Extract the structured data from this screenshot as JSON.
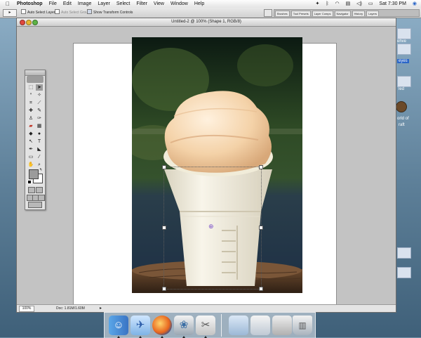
{
  "menubar": {
    "apple": "",
    "items": [
      "Photoshop",
      "File",
      "Edit",
      "Image",
      "Layer",
      "Select",
      "Filter",
      "View",
      "Window",
      "Help"
    ],
    "clock": "Sat 7:30 PM"
  },
  "options_bar": {
    "tool_glyph": "▸",
    "auto_select_layer": "Auto Select Layer",
    "auto_select_groups": "Auto Select Groups",
    "show_transform_controls": "Show Transform Controls",
    "palette_tabs": [
      "Brushes",
      "Tool Presets",
      "Layer Comps",
      "Navigator",
      "History",
      "Layers"
    ]
  },
  "document": {
    "title": "Untitled-2 @ 100% (Shape 1, RGB/8)",
    "zoom": "100%",
    "doc_size": "Doc: 1.81M/1.60M"
  },
  "desktop": {
    "labels": [
      "ehve",
      "eyes",
      "led",
      "orld of",
      "raft"
    ]
  },
  "colors": {
    "desktop": "#6f8fa6",
    "canvas_bg": "#c3c3c3",
    "menubar": "#eeeeee",
    "selection": "#2b66c7",
    "icecream": "#f4d2a8",
    "cone": "#f3efe1"
  },
  "dock": {
    "icons": [
      "finder-icon",
      "mail-icon",
      "firefox-icon",
      "iphoto-icon",
      "preview-icon",
      "folder-icon",
      "finder-window-icon",
      "document-icon",
      "trash-icon"
    ]
  }
}
